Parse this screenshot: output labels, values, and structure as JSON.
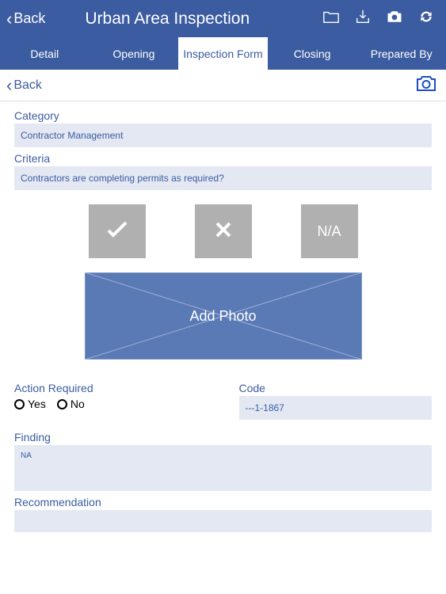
{
  "header": {
    "back_label": "Back",
    "title": "Urban Area Inspection"
  },
  "tabs": [
    {
      "label": "Detail",
      "active": false
    },
    {
      "label": "Opening",
      "active": false
    },
    {
      "label": "Inspection Form",
      "active": true
    },
    {
      "label": "Closing",
      "active": false
    },
    {
      "label": "Prepared By",
      "active": false
    }
  ],
  "subheader": {
    "back_label": "Back"
  },
  "form": {
    "category_label": "Category",
    "category_value": "Contractor Management",
    "criteria_label": "Criteria",
    "criteria_value": "Contractors are completing permits as required?",
    "na_label": "N/A",
    "add_photo_label": "Add Photo",
    "action_required_label": "Action Required",
    "yes_label": "Yes",
    "no_label": "No",
    "code_label": "Code",
    "code_value": "---1-1867",
    "finding_label": "Finding",
    "finding_value": "NA",
    "recommendation_label": "Recommendation"
  }
}
